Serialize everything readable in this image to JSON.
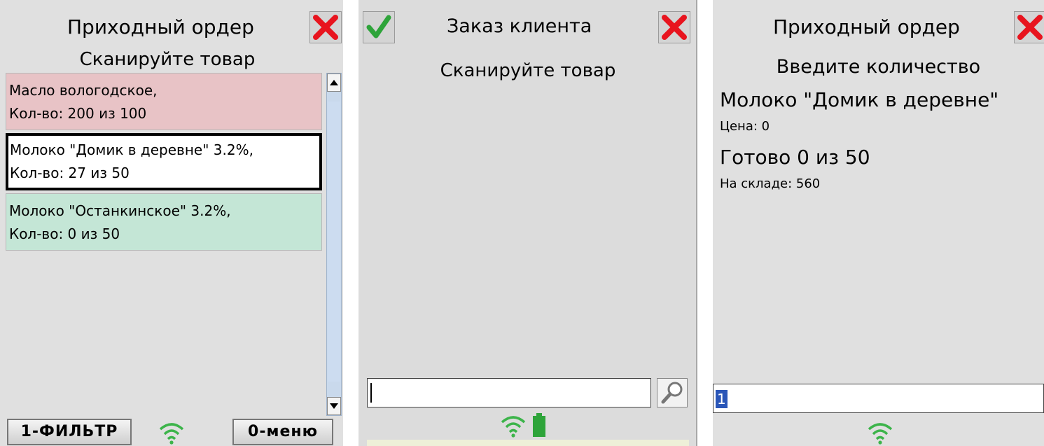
{
  "screen1": {
    "title": "Приходный ордер",
    "subtitle": "Сканируйте товар",
    "items": [
      {
        "line1": "Масло вологодское,",
        "line2": "Кол-во: 200 из 100",
        "status": "red"
      },
      {
        "line1": "Молоко \"Домик в деревне\" 3.2%,",
        "line2": "Кол-во: 27 из 50",
        "status": "selected"
      },
      {
        "line1": "Молоко \"Останкинское\" 3.2%,",
        "line2": "Кол-во: 0 из 50",
        "status": "green"
      }
    ],
    "softkey_left": "1-ФИЛЬТР",
    "softkey_right": "0-меню"
  },
  "screen2": {
    "title": "Заказ клиента",
    "subtitle": "Сканируйте товар",
    "scan_value": ""
  },
  "screen3": {
    "title": "Приходный ордер",
    "prompt": "Введите количество",
    "product": "Молоко \"Домик в деревне\"",
    "price": "Цена: 0",
    "progress": "Готово 0 из 50",
    "stock": "На складе: 560",
    "quantity_value": "1"
  },
  "colors": {
    "row_red": "#e8c3c6",
    "row_green": "#c4e6d6",
    "close_red": "#e8141e",
    "ok_green": "#2ea43a",
    "wifi_green": "#3cb44a",
    "battery_green": "#2ea43a",
    "selection_blue": "#2a56b8"
  },
  "icons": [
    "close-icon",
    "checkmark-icon",
    "wifi-icon",
    "battery-icon",
    "search-icon"
  ]
}
